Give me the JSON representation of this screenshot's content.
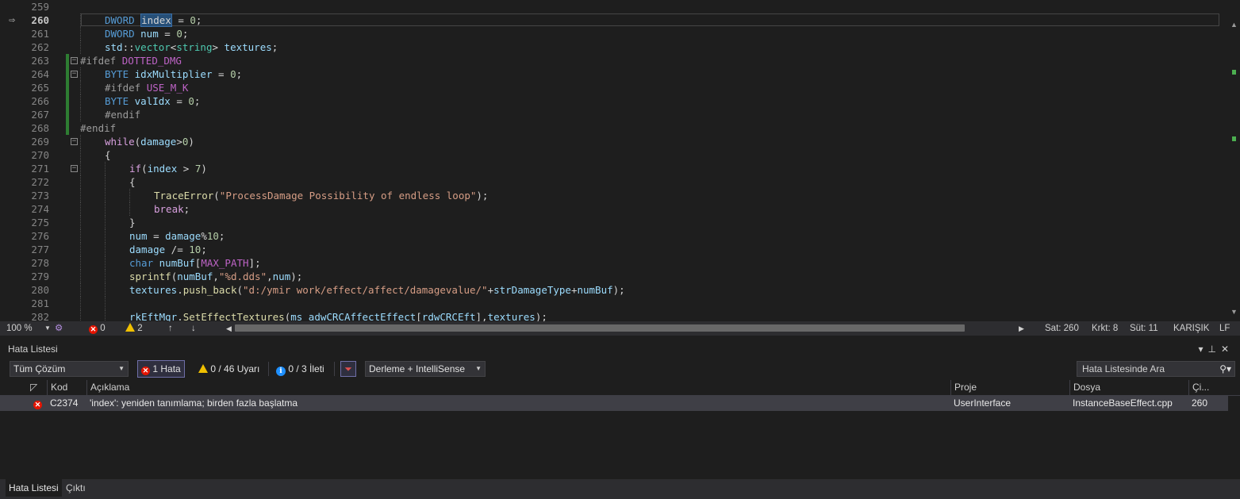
{
  "editor": {
    "current_line": 260,
    "lines": [
      {
        "n": "259",
        "indent": 0,
        "tokens": []
      },
      {
        "n": "260",
        "indent": 1,
        "tokens": [
          [
            "kw",
            "DWORD "
          ],
          [
            "sel",
            "index"
          ],
          [
            "pl",
            " = "
          ],
          [
            "num",
            "0"
          ],
          [
            "pl",
            ";"
          ]
        ]
      },
      {
        "n": "261",
        "indent": 1,
        "tokens": [
          [
            "kw",
            "DWORD "
          ],
          [
            "var",
            "num"
          ],
          [
            "pl",
            " = "
          ],
          [
            "num",
            "0"
          ],
          [
            "pl",
            ";"
          ]
        ]
      },
      {
        "n": "262",
        "indent": 1,
        "tokens": [
          [
            "var",
            "std"
          ],
          [
            "pl",
            "::"
          ],
          [
            "ty",
            "vector"
          ],
          [
            "pl",
            "<"
          ],
          [
            "ty",
            "string"
          ],
          [
            "pl",
            "> "
          ],
          [
            "var",
            "textures"
          ],
          [
            "pl",
            ";"
          ]
        ]
      },
      {
        "n": "263",
        "indent": 0,
        "tokens": [
          [
            "pp",
            "#ifdef "
          ],
          [
            "mac",
            "DOTTED_DMG"
          ]
        ]
      },
      {
        "n": "264",
        "indent": 1,
        "tokens": [
          [
            "kw",
            "BYTE "
          ],
          [
            "var",
            "idxMultiplier"
          ],
          [
            "pl",
            " = "
          ],
          [
            "num",
            "0"
          ],
          [
            "pl",
            ";"
          ]
        ]
      },
      {
        "n": "265",
        "indent": 1,
        "tokens": [
          [
            "pp",
            "#ifdef "
          ],
          [
            "mac",
            "USE_M_K"
          ]
        ]
      },
      {
        "n": "266",
        "indent": 1,
        "tokens": [
          [
            "kw",
            "BYTE "
          ],
          [
            "var",
            "valIdx"
          ],
          [
            "pl",
            " = "
          ],
          [
            "num",
            "0"
          ],
          [
            "pl",
            ";"
          ]
        ]
      },
      {
        "n": "267",
        "indent": 1,
        "tokens": [
          [
            "pp",
            "#endif"
          ]
        ]
      },
      {
        "n": "268",
        "indent": 0,
        "tokens": [
          [
            "pp",
            "#endif"
          ]
        ]
      },
      {
        "n": "269",
        "indent": 1,
        "tokens": [
          [
            "ctl",
            "while"
          ],
          [
            "pl",
            "("
          ],
          [
            "var",
            "damage"
          ],
          [
            "pl",
            ">"
          ],
          [
            "num",
            "0"
          ],
          [
            "pl",
            ")"
          ]
        ]
      },
      {
        "n": "270",
        "indent": 1,
        "tokens": [
          [
            "pl",
            "{"
          ]
        ]
      },
      {
        "n": "271",
        "indent": 2,
        "tokens": [
          [
            "ctl",
            "if"
          ],
          [
            "pl",
            "("
          ],
          [
            "var",
            "index"
          ],
          [
            "pl",
            " > "
          ],
          [
            "num",
            "7"
          ],
          [
            "pl",
            ")"
          ]
        ]
      },
      {
        "n": "272",
        "indent": 2,
        "tokens": [
          [
            "pl",
            "{"
          ]
        ]
      },
      {
        "n": "273",
        "indent": 3,
        "tokens": [
          [
            "fn",
            "TraceError"
          ],
          [
            "pl",
            "("
          ],
          [
            "str",
            "\"ProcessDamage Possibility of endless loop\""
          ],
          [
            "pl",
            ");"
          ]
        ]
      },
      {
        "n": "274",
        "indent": 3,
        "tokens": [
          [
            "ctl",
            "break"
          ],
          [
            "pl",
            ";"
          ]
        ]
      },
      {
        "n": "275",
        "indent": 2,
        "tokens": [
          [
            "pl",
            "}"
          ]
        ]
      },
      {
        "n": "276",
        "indent": 2,
        "tokens": [
          [
            "var",
            "num"
          ],
          [
            "pl",
            " = "
          ],
          [
            "var",
            "damage"
          ],
          [
            "pl",
            "%"
          ],
          [
            "num",
            "10"
          ],
          [
            "pl",
            ";"
          ]
        ]
      },
      {
        "n": "277",
        "indent": 2,
        "tokens": [
          [
            "var",
            "damage"
          ],
          [
            "pl",
            " /= "
          ],
          [
            "num",
            "10"
          ],
          [
            "pl",
            ";"
          ]
        ]
      },
      {
        "n": "278",
        "indent": 2,
        "tokens": [
          [
            "kw",
            "char "
          ],
          [
            "var",
            "numBuf"
          ],
          [
            "pl",
            "["
          ],
          [
            "mac",
            "MAX_PATH"
          ],
          [
            "pl",
            "];"
          ]
        ]
      },
      {
        "n": "279",
        "indent": 2,
        "tokens": [
          [
            "fn",
            "sprintf"
          ],
          [
            "pl",
            "("
          ],
          [
            "var",
            "numBuf"
          ],
          [
            "pl",
            ","
          ],
          [
            "str",
            "\"%d.dds\""
          ],
          [
            "pl",
            ","
          ],
          [
            "var",
            "num"
          ],
          [
            "pl",
            ");"
          ]
        ]
      },
      {
        "n": "280",
        "indent": 2,
        "tokens": [
          [
            "var",
            "textures"
          ],
          [
            "pl",
            "."
          ],
          [
            "fn",
            "push_back"
          ],
          [
            "pl",
            "("
          ],
          [
            "str",
            "\"d:/ymir work/effect/affect/damagevalue/\""
          ],
          [
            "pl",
            "+"
          ],
          [
            "var",
            "strDamageType"
          ],
          [
            "pl",
            "+"
          ],
          [
            "var",
            "numBuf"
          ],
          [
            "pl",
            ");"
          ]
        ]
      },
      {
        "n": "281",
        "indent": 2,
        "tokens": []
      },
      {
        "n": "282",
        "indent": 2,
        "tokens": [
          [
            "var",
            "rkEftMgr"
          ],
          [
            "pl",
            "."
          ],
          [
            "fn",
            "SetEffectTextures"
          ],
          [
            "pl",
            "("
          ],
          [
            "var",
            "ms_adwCRCAffectEffect"
          ],
          [
            "pl",
            "["
          ],
          [
            "var",
            "rdwCRCEft"
          ],
          [
            "pl",
            "],"
          ],
          [
            "var",
            "textures"
          ],
          [
            "pl",
            ");"
          ]
        ]
      }
    ]
  },
  "status": {
    "zoom": "100 %",
    "errors": "0",
    "warnings": "2",
    "line": "Sat: 260",
    "char": "Krkt: 8",
    "col": "Süt: 11",
    "encoding": "KARIŞIK",
    "eol": "LF"
  },
  "panel": {
    "title": "Hata Listesi",
    "scope": "Tüm Çözüm",
    "errors_btn": "1 Hata",
    "warnings_btn": "0 / 46 Uyarı",
    "messages_btn": "0 / 3 İleti",
    "build_filter": "Derleme + IntelliSense",
    "search_placeholder": "Hata Listesinde Ara",
    "columns": [
      "Kod",
      "Açıklama",
      "Proje",
      "Dosya",
      "Çi..."
    ],
    "rows": [
      {
        "code": "C2374",
        "desc": "'index': yeniden tanımlama; birden fazla başlatma",
        "project": "UserInterface",
        "file": "InstanceBaseEffect.cpp",
        "line": "260"
      }
    ],
    "tabs": [
      "Hata Listesi",
      "Çıktı"
    ]
  }
}
